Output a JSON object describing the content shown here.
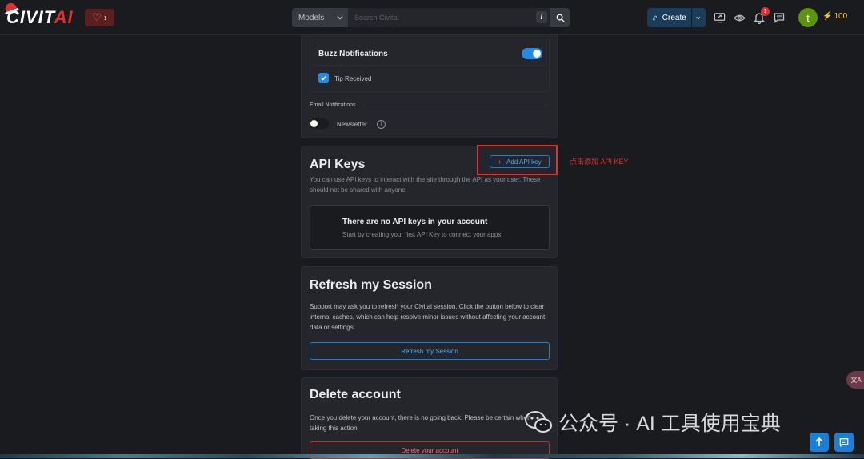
{
  "header": {
    "logo": {
      "main": "CIVIT",
      "accent": "AI"
    },
    "heart_chevron": "›",
    "search": {
      "category": "Models",
      "placeholder": "Search Civitai",
      "hotkey": "/"
    },
    "create_label": "Create",
    "notification_count": "1",
    "avatar_initial": "t",
    "buzz_amount": "100"
  },
  "notifications_card": {
    "buzz_notifications_label": "Buzz Notifications",
    "buzz_notifications_enabled": true,
    "tip_received_label": "Tip Received",
    "tip_received_checked": true,
    "email_notifications_label": "Email Notifications",
    "newsletter_label": "Newsletter",
    "newsletter_enabled": false
  },
  "api_keys": {
    "title": "API Keys",
    "add_button": "Add API key",
    "description": "You can use API keys to interact with the site through the API as your user. These should not be shared with anyone.",
    "empty_title": "There are no API keys in your account",
    "empty_subtitle": "Start by creating your first API Key to connect your apps."
  },
  "annotation": {
    "text": "点击添加 API KEY",
    "color": "#e03131"
  },
  "refresh_session": {
    "title": "Refresh my Session",
    "description": "Support may ask you to refresh your Civitai session. Click the button below to clear internal caches, which can help resolve minor issues without affecting your account data or settings.",
    "button": "Refresh my Session"
  },
  "delete_account": {
    "title": "Delete account",
    "description": "Once you delete your account, there is no going back. Please be certain when taking this action.",
    "button": "Delete your account"
  },
  "watermark": {
    "text": "公众号 · AI 工具使用宝典"
  },
  "translate_bubble": "文A",
  "colors": {
    "accent": "#228be6",
    "danger": "#e03131",
    "background": "#1a1b1e",
    "card": "#25262b",
    "buzz": "#fcc419"
  }
}
